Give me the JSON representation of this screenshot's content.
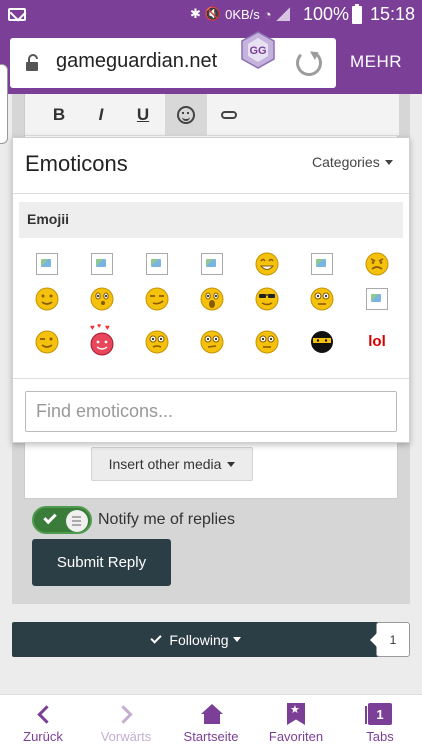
{
  "status_bar": {
    "network": "0KB/s",
    "battery": "100%",
    "time": "15:18"
  },
  "browser": {
    "url": "gameguardian.net",
    "menu_label": "MEHR",
    "badge_text": "GG"
  },
  "editor": {
    "toolbar": [
      {
        "label": "B",
        "icon": "bold-icon"
      },
      {
        "label": "I",
        "icon": "italic-icon"
      },
      {
        "label": "U",
        "icon": "underline-icon"
      },
      {
        "label": "",
        "icon": "emoticon-icon"
      },
      {
        "label": "",
        "icon": "link-icon"
      }
    ],
    "insert_media_label": "Insert other media"
  },
  "emoticons": {
    "title": "Emoticons",
    "categories_label": "Categories",
    "section_label": "Emojii",
    "search_placeholder": "Find emoticons...",
    "rows": [
      [
        "broken-image",
        "broken-image",
        "broken-image",
        "broken-image",
        "grin",
        "broken-image",
        "angry"
      ],
      [
        "smile",
        "confused",
        "smirk",
        "surprised",
        "cool",
        "rolleyes",
        "broken-image"
      ],
      [
        "wink",
        "love",
        "unsure",
        "blink",
        "wacko",
        "ninja",
        "lol"
      ]
    ],
    "lol_text": "lol"
  },
  "reply": {
    "notify_label": "Notify me of replies",
    "submit_label": "Submit Reply"
  },
  "follow": {
    "label": "Following",
    "count": "1"
  },
  "bottom_nav": {
    "back": "Zurück",
    "forward": "Vorwärts",
    "home": "Startseite",
    "favorites": "Favoriten",
    "tabs": "Tabs",
    "tab_count": "1"
  },
  "colors": {
    "brand": "#7b3f98",
    "dark_button": "#2c3e45",
    "toggle_on": "#3a7d3a",
    "emoji_yellow": "#f4c20d"
  }
}
